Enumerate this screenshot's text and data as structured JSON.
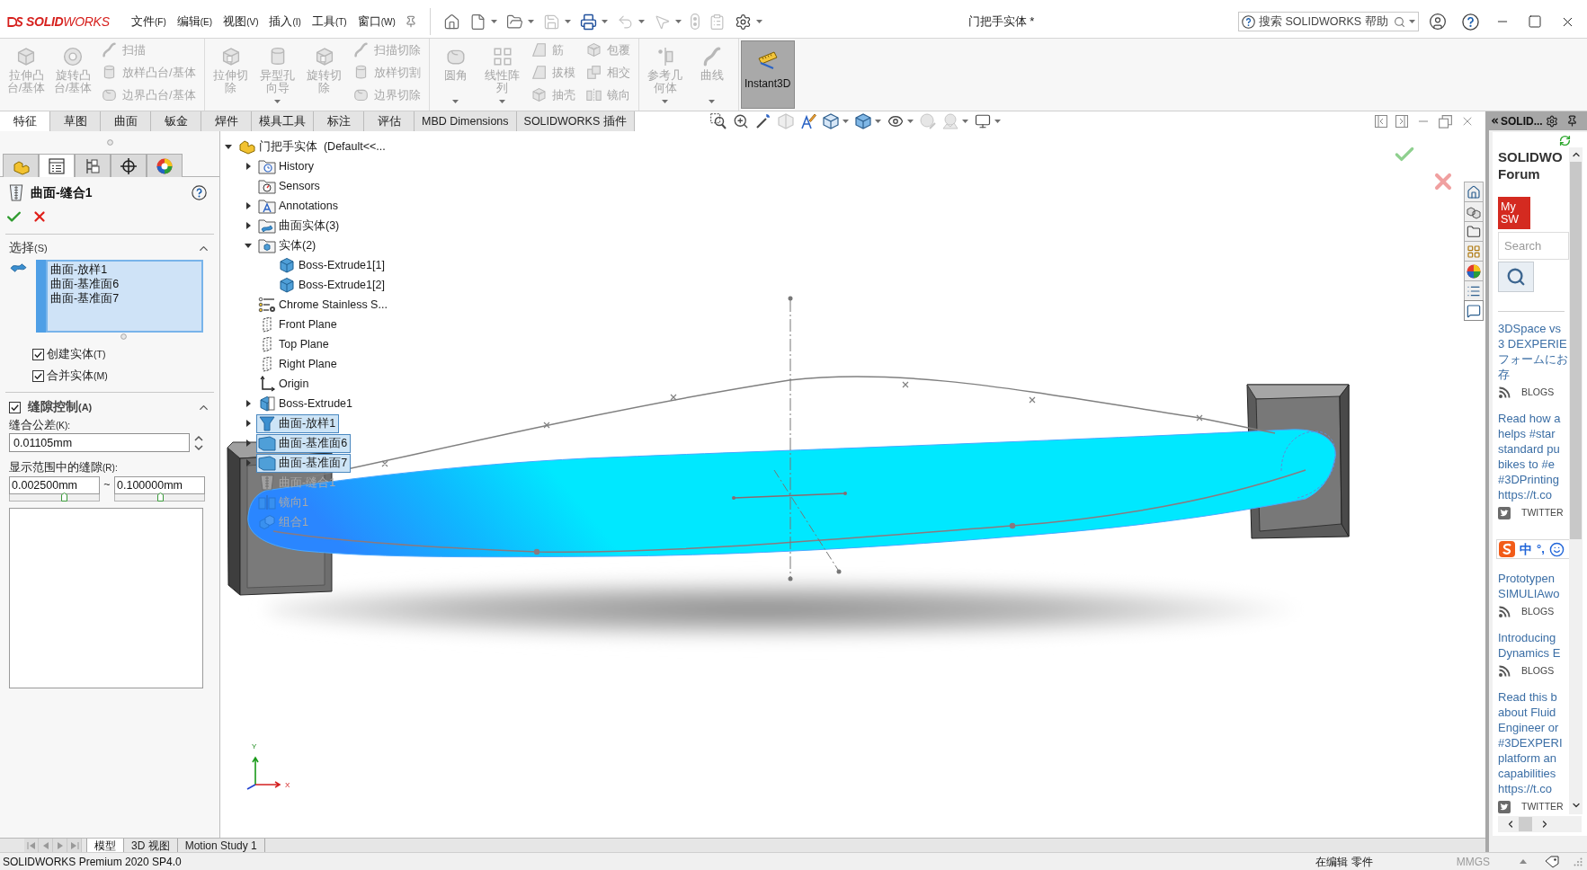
{
  "title_bar": {
    "logo": "**SOLID**WORKS",
    "menus": [
      {
        "label": "文件",
        "hotkey": "(F)"
      },
      {
        "label": "编辑",
        "hotkey": "(E)"
      },
      {
        "label": "视图",
        "hotkey": "(V)"
      },
      {
        "label": "插入",
        "hotkey": "(I)"
      },
      {
        "label": "工具",
        "hotkey": "(T)"
      },
      {
        "label": "窗口",
        "hotkey": "(W)"
      }
    ],
    "quick_access": [
      {
        "kind": "home",
        "disabled": false,
        "dropdown": false
      },
      {
        "kind": "new",
        "disabled": false,
        "dropdown": true
      },
      {
        "kind": "open",
        "disabled": false,
        "dropdown": true
      },
      {
        "kind": "save",
        "disabled": true,
        "dropdown": true
      },
      {
        "kind": "print",
        "disabled": false,
        "dropdown": true
      },
      {
        "kind": "undo",
        "disabled": true,
        "dropdown": true
      },
      {
        "kind": "select",
        "disabled": true,
        "dropdown": true
      },
      {
        "kind": "rebuild",
        "disabled": true,
        "dropdown": false
      },
      {
        "kind": "file-properties",
        "disabled": true,
        "dropdown": false
      },
      {
        "kind": "options",
        "disabled": false,
        "dropdown": true
      }
    ],
    "document_title": "门把手实体 *",
    "search": {
      "placeholder": "搜索 SOLIDWORKS 帮助"
    }
  },
  "ribbon": {
    "groups": [
      {
        "large": [
          {
            "label": "拉伸凸台/基体",
            "kind": "extrude-boss",
            "disabled": true,
            "dropdown": false
          },
          {
            "label": "旋转凸台/基体",
            "kind": "revolve-boss",
            "disabled": true,
            "dropdown": false
          }
        ],
        "small": [
          {
            "label": "扫描",
            "kind": "sweep",
            "disabled": true,
            "dropdown": false
          },
          {
            "label": "放样凸台/基体",
            "kind": "loft",
            "disabled": true,
            "dropdown": false
          },
          {
            "label": "边界凸台/基体",
            "kind": "boundary",
            "disabled": true,
            "dropdown": false
          }
        ]
      },
      {
        "large": [
          {
            "label": "拉伸切除",
            "kind": "extrude-cut",
            "disabled": true,
            "dropdown": false
          },
          {
            "label": "异型孔向导",
            "kind": "hole-wizard",
            "disabled": true,
            "dropdown": true
          },
          {
            "label": "旋转切除",
            "kind": "revolve-cut",
            "disabled": true,
            "dropdown": false
          }
        ],
        "small": [
          {
            "label": "扫描切除",
            "kind": "sweep-cut",
            "disabled": true,
            "dropdown": false
          },
          {
            "label": "放样切割",
            "kind": "loft-cut",
            "disabled": true,
            "dropdown": false
          },
          {
            "label": "边界切除",
            "kind": "boundary-cut",
            "disabled": true,
            "dropdown": false
          }
        ]
      },
      {
        "large": [
          {
            "label": "圆角",
            "kind": "fillet",
            "disabled": true,
            "dropdown": true
          },
          {
            "label": "线性阵列",
            "kind": "linear-pattern",
            "disabled": true,
            "dropdown": true
          }
        ],
        "small": [
          {
            "label": "筋",
            "kind": "rib",
            "disabled": true,
            "dropdown": false
          },
          {
            "label": "拔模",
            "kind": "draft",
            "disabled": true,
            "dropdown": false
          },
          {
            "label": "抽壳",
            "kind": "shell",
            "disabled": true,
            "dropdown": false
          },
          {
            "label": "包覆",
            "kind": "wrap",
            "disabled": true,
            "dropdown": false
          },
          {
            "label": "相交",
            "kind": "intersect",
            "disabled": true,
            "dropdown": false
          },
          {
            "label": "镜向",
            "kind": "mirror",
            "disabled": true,
            "dropdown": false
          }
        ]
      },
      {
        "large": [
          {
            "label": "参考几何体",
            "kind": "reference-geometry",
            "disabled": true,
            "dropdown": true
          },
          {
            "label": "曲线",
            "kind": "curves",
            "disabled": true,
            "dropdown": true
          }
        ]
      }
    ],
    "instant3d": {
      "label": "Instant3D",
      "on": true
    }
  },
  "command_tabs": [
    {
      "label": "特征",
      "selected": true
    },
    {
      "label": "草图",
      "selected": false
    },
    {
      "label": "曲面",
      "selected": false
    },
    {
      "label": "钣金",
      "selected": false
    },
    {
      "label": "焊件",
      "selected": false
    },
    {
      "label": "模具工具",
      "selected": false
    },
    {
      "label": "标注",
      "selected": false
    },
    {
      "label": "评估",
      "selected": false
    },
    {
      "label": "MBD Dimensions",
      "selected": false
    },
    {
      "label": "SOLIDWORKS 插件",
      "selected": false
    }
  ],
  "view_toolbar": [
    {
      "kind": "zoom-to-fit",
      "disabled": false,
      "dropdown": false
    },
    {
      "kind": "zoom-to-area",
      "disabled": false,
      "dropdown": false
    },
    {
      "kind": "previous-view",
      "disabled": false,
      "dropdown": false
    },
    {
      "kind": "section-view",
      "disabled": true,
      "dropdown": false
    },
    {
      "kind": "dynamic-annotation",
      "disabled": false,
      "dropdown": false
    },
    {
      "kind": "view-orientation",
      "disabled": false,
      "dropdown": true
    },
    {
      "kind": "display-style",
      "disabled": false,
      "dropdown": true
    },
    {
      "kind": "hide-show",
      "disabled": false,
      "dropdown": true
    },
    {
      "kind": "edit-appearance",
      "disabled": true,
      "dropdown": false
    },
    {
      "kind": "apply-scene",
      "disabled": true,
      "dropdown": true
    },
    {
      "kind": "view-settings",
      "disabled": false,
      "dropdown": true
    }
  ],
  "property_manager": {
    "tabs": [
      {
        "kind": "feature-tree",
        "selected": false
      },
      {
        "kind": "property",
        "selected": true
      },
      {
        "kind": "configuration",
        "selected": false
      },
      {
        "kind": "dimxpert",
        "selected": false
      },
      {
        "kind": "display",
        "selected": false
      }
    ],
    "title": "曲面-缝合1",
    "selection": {
      "heading": "选择",
      "hotkey": "(S)",
      "expanded": true,
      "items": [
        "曲面-放样1",
        "曲面-基准面6",
        "曲面-基准面7"
      ]
    },
    "options": [
      {
        "label": "创建实体",
        "hotkey": "(T)",
        "checked": true
      },
      {
        "label": "合并实体",
        "hotkey": "(M)",
        "checked": true
      }
    ],
    "gap_control": {
      "heading": "缝隙控制",
      "hotkey": "(A)",
      "checked": true,
      "expanded": true,
      "tolerance": {
        "label": "缝合公差",
        "hotkey": "(K):",
        "value": "0.01105mm"
      },
      "range": {
        "label": "显示范围中的缝隙",
        "hotkey": "(R):",
        "min": {
          "value": "0.002500mm",
          "level": 0.61
        },
        "separator": "~",
        "max": {
          "value": "0.100000mm",
          "level": 0.5
        }
      }
    }
  },
  "feature_tree": {
    "items": [
      {
        "label": "门把手实体  (Default<<...",
        "kind": "part",
        "expanded": true,
        "selected": false,
        "rolled_back": false,
        "children": [
          {
            "label": "History",
            "kind": "history",
            "expanded": false,
            "selected": false,
            "rolled_back": false
          },
          {
            "label": "Sensors",
            "kind": "sensors",
            "selected": false,
            "rolled_back": false
          },
          {
            "label": "Annotations",
            "kind": "annotations",
            "expanded": false,
            "selected": false,
            "rolled_back": false
          },
          {
            "label": "曲面实体(3)",
            "kind": "surface-bodies",
            "expanded": false,
            "selected": false,
            "rolled_back": false
          },
          {
            "label": "实体(2)",
            "kind": "solid-bodies",
            "expanded": true,
            "selected": false,
            "rolled_back": false,
            "children": [
              {
                "label": "Boss-Extrude1[1]",
                "kind": "body",
                "selected": false,
                "rolled_back": false
              },
              {
                "label": "Boss-Extrude1[2]",
                "kind": "body",
                "selected": false,
                "rolled_back": false
              }
            ]
          },
          {
            "label": "Chrome Stainless S...",
            "kind": "material",
            "selected": false,
            "rolled_back": false
          },
          {
            "label": "Front Plane",
            "kind": "plane",
            "selected": false,
            "rolled_back": false
          },
          {
            "label": "Top Plane",
            "kind": "plane",
            "selected": false,
            "rolled_back": false
          },
          {
            "label": "Right Plane",
            "kind": "plane",
            "selected": false,
            "rolled_back": false
          },
          {
            "label": "Origin",
            "kind": "origin",
            "selected": false,
            "rolled_back": false
          },
          {
            "label": "Boss-Extrude1",
            "kind": "extrude",
            "expanded": false,
            "selected": false,
            "rolled_back": false
          },
          {
            "label": "曲面-放样1",
            "kind": "loft-surface",
            "expanded": false,
            "selected": true,
            "rolled_back": false
          },
          {
            "label": "曲面-基准面6",
            "kind": "planar-surface",
            "expanded": false,
            "selected": true,
            "rolled_back": false
          },
          {
            "label": "曲面-基准面7",
            "kind": "planar-surface",
            "expanded": false,
            "selected": true,
            "rolled_back": false
          },
          {
            "label": "曲面-缝合1",
            "kind": "knit",
            "selected": false,
            "rolled_back": true
          },
          {
            "label": "镜向1",
            "kind": "mirror",
            "selected": false,
            "rolled_back": true
          },
          {
            "label": "组合1",
            "kind": "combine",
            "selected": false,
            "rolled_back": true
          }
        ]
      }
    ]
  },
  "graphics": {
    "triad": {
      "y_label": "Y",
      "x_label": "X"
    }
  },
  "task_pane": {
    "title": "SOLID...",
    "tabs": [
      {
        "kind": "home",
        "selected": false
      },
      {
        "kind": "design-library",
        "selected": false
      },
      {
        "kind": "file-explorer",
        "selected": false
      },
      {
        "kind": "view-palette",
        "selected": false
      },
      {
        "kind": "appearances",
        "selected": false
      },
      {
        "kind": "custom-properties",
        "selected": false
      },
      {
        "kind": "forum",
        "selected": true
      }
    ],
    "heading": [
      "SOLIDWO",
      "Forum"
    ],
    "logo": [
      "My",
      "SW"
    ],
    "search": {
      "placeholder": "Search"
    },
    "posts": [
      {
        "lines": [
          "3DSpace vs",
          "3 DEXPERIE",
          "フォームにお",
          "存"
        ],
        "source": "BLOGS",
        "kind": "blog"
      },
      {
        "lines": [
          "Read how a",
          "helps #star",
          "standard pu",
          "bikes to #e",
          "#3DPrinting",
          "https://t.co"
        ],
        "source": "TWITTER",
        "kind": "twitter"
      },
      {
        "lines": [
          "Prototypen",
          "SIMULIAwo"
        ],
        "source": "BLOGS",
        "kind": "blog"
      },
      {
        "lines": [
          "Introducing",
          "Dynamics E"
        ],
        "source": "BLOGS",
        "kind": "blog"
      },
      {
        "lines": [
          "Read this b",
          "about Fluid",
          "Engineer or",
          "#3DEXPERI",
          "platform an",
          "capabilities",
          "https://t.co"
        ],
        "source": "TWITTER",
        "kind": "twitter"
      }
    ]
  },
  "ime_toolbar": {
    "mode": "中",
    "punctuation": "°,"
  },
  "bottom_tabs": [
    {
      "label": "模型",
      "selected": true
    },
    {
      "label": "3D 视图",
      "selected": false
    },
    {
      "label": "Motion Study 1",
      "selected": false
    }
  ],
  "status_bar": {
    "version": "SOLIDWORKS Premium 2020 SP4.0",
    "mode": "在编辑 零件",
    "units": "MMGS",
    "units_disabled": true
  }
}
